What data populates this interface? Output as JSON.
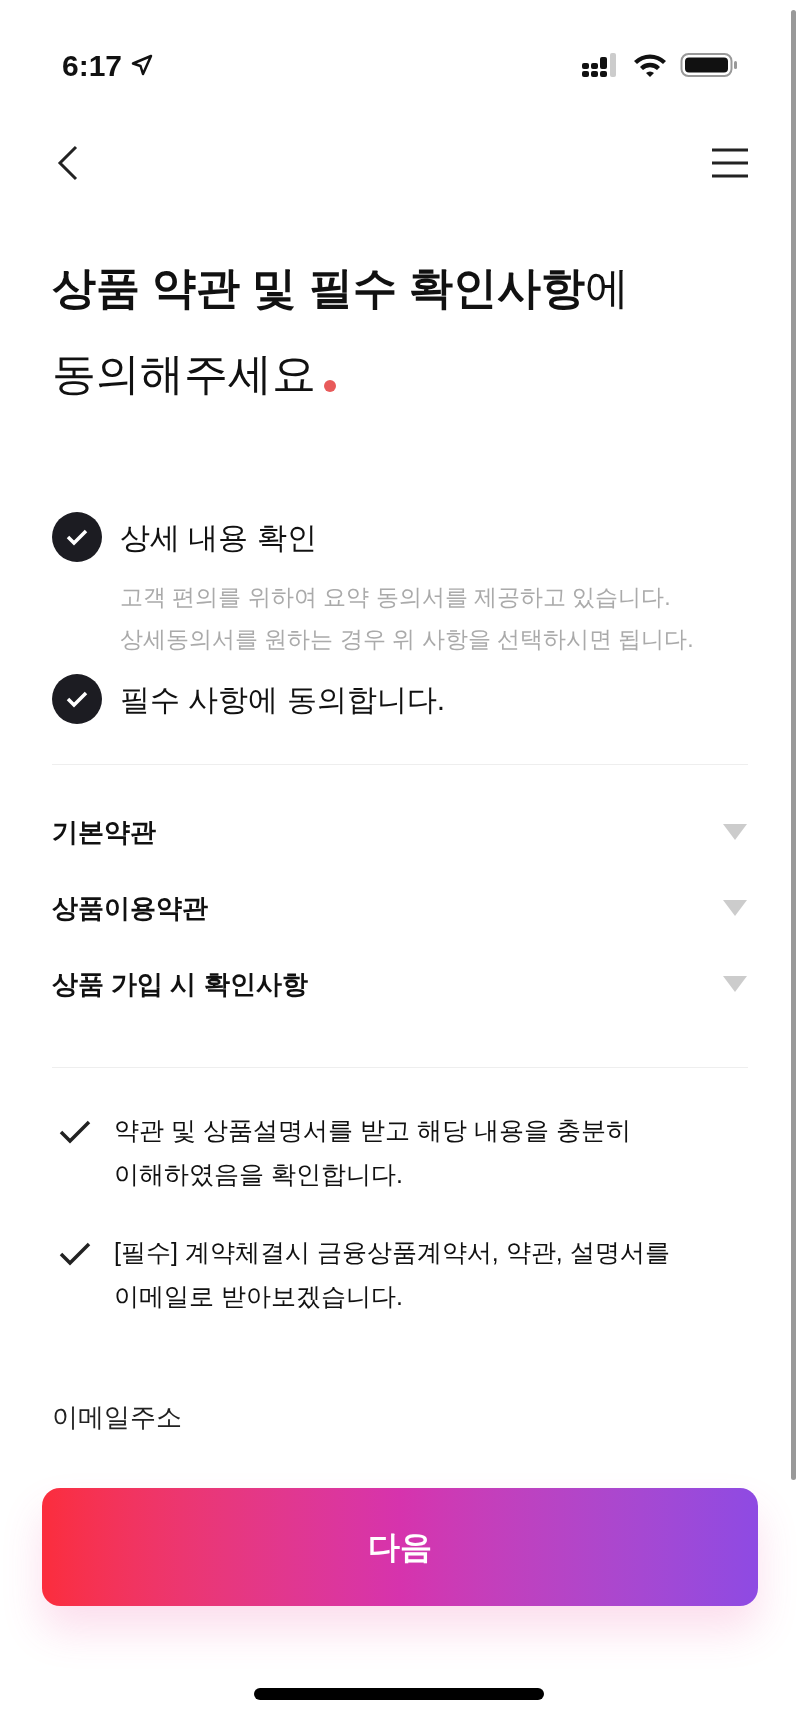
{
  "status_bar": {
    "time": "6:17"
  },
  "title": {
    "line1": "**상품 약관 및 필수 확인사항**에",
    "line2": "동의해주세요"
  },
  "agreements": [
    {
      "label": "상세 내용 확인",
      "checked": true,
      "description": "고객 편의를 위하여 요약 동의서를 제공하고 있습니다. 상세동의서를 원하는 경우 위 사항을 선택하시면 됩니다."
    },
    {
      "label": "필수 사항에 동의합니다.",
      "checked": true
    }
  ],
  "sections": [
    {
      "label": "기본약관",
      "expanded": false
    },
    {
      "label": "상품이용약관",
      "expanded": false
    },
    {
      "label": "상품 가입 시 확인사항",
      "expanded": false
    }
  ],
  "consents": [
    {
      "text": "약관 및 상품설명서를 받고 해당 내용을 충분히 이해하였음을 확인합니다.",
      "checked": true
    },
    {
      "text": "[필수] 계약체결시 금융상품계약서, 약관, 설명서를 이메일로 받아보겠습니다.",
      "checked": true
    }
  ],
  "email": {
    "label": "이메일주소"
  },
  "next_button": "다음"
}
